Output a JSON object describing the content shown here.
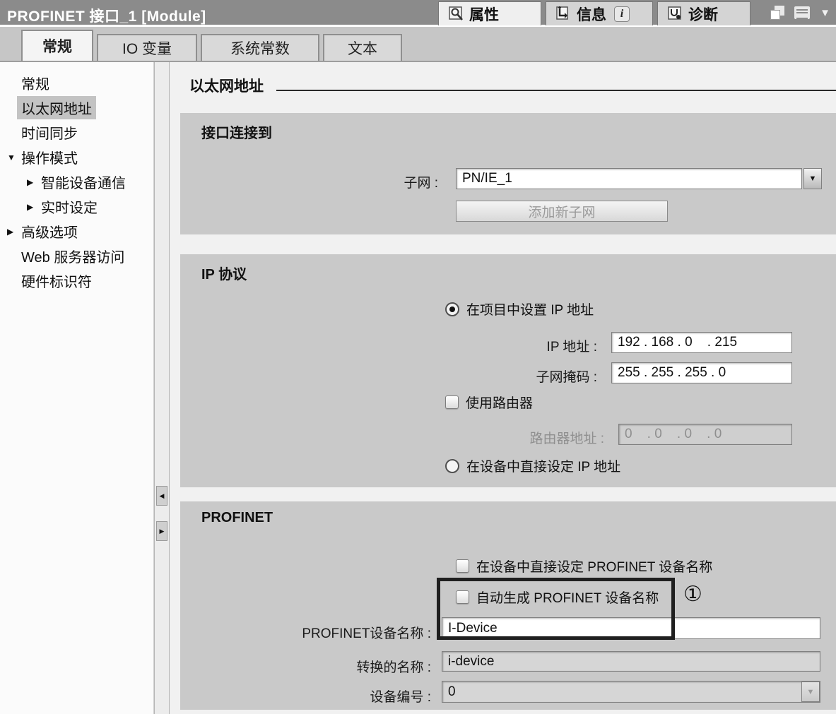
{
  "titlebar": {
    "title": "PROFINET 接口_1 [Module]",
    "inspector_tabs": {
      "properties": "属性",
      "info": "信息",
      "diagnostics": "诊断"
    },
    "info_badge": "i"
  },
  "tabs": {
    "general": "常规",
    "io_tags": "IO 变量",
    "system_constants": "系统常数",
    "texts": "文本"
  },
  "sidebar": {
    "items": [
      {
        "label": "常规",
        "arrow": ""
      },
      {
        "label": "以太网地址",
        "arrow": ""
      },
      {
        "label": "时间同步",
        "arrow": ""
      },
      {
        "label": "操作模式",
        "arrow": "▼"
      },
      {
        "label": "智能设备通信",
        "arrow": "▶"
      },
      {
        "label": "实时设定",
        "arrow": "▶"
      },
      {
        "label": "高级选项",
        "arrow": "▶"
      },
      {
        "label": "Web 服务器访问",
        "arrow": ""
      },
      {
        "label": "硬件标识符",
        "arrow": ""
      }
    ]
  },
  "content": {
    "heading": "以太网地址",
    "interface_panel": {
      "title": "接口连接到",
      "subnet_label": "子网 :",
      "subnet_value": "PN/IE_1",
      "add_subnet_button": "添加新子网"
    },
    "ip_panel": {
      "title": "IP 协议",
      "radio_project": "在项目中设置 IP 地址",
      "ip_label": "IP 地址 :",
      "ip_value": "192 . 168 . 0    . 215",
      "mask_label": "子网掩码 :",
      "mask_value": "255 . 255 . 255 . 0",
      "router_checkbox": "使用路由器",
      "router_label": "路由器地址 :",
      "router_value": "0    . 0    . 0    . 0",
      "radio_device": "在设备中直接设定 IP 地址"
    },
    "profinet_panel": {
      "title": "PROFINET",
      "checkbox_direct": "在设备中直接设定 PROFINET 设备名称",
      "checkbox_auto": "自动生成 PROFINET 设备名称",
      "annotation": "①",
      "name_label": "PROFINET设备名称 :",
      "name_value": "I-Device",
      "converted_label": "转换的名称 :",
      "converted_value": "i-device",
      "number_label": "设备编号 :",
      "number_value": "0"
    }
  },
  "icons": {
    "dropdown_arrow": "▼",
    "collapse_arrow": "▼",
    "splitter_left": "◀",
    "splitter_right": "▶"
  }
}
